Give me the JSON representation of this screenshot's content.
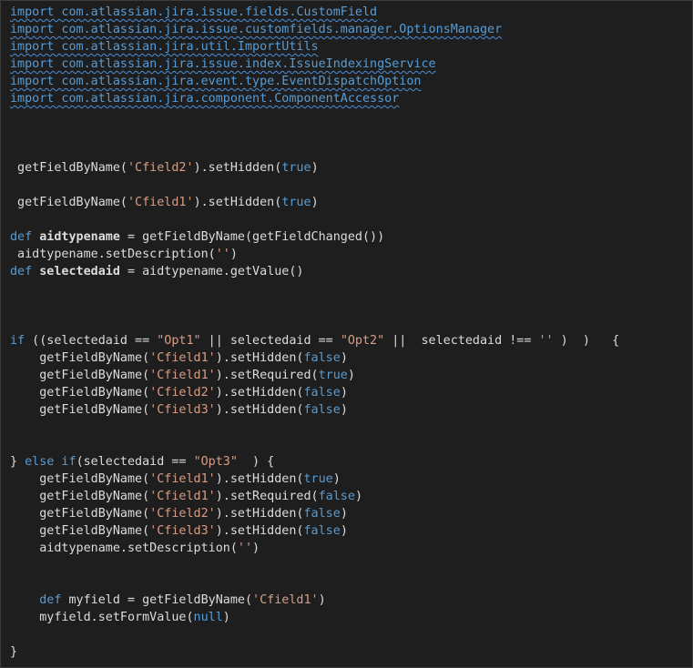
{
  "colors": {
    "background": "#1e1e1e",
    "border": "#3c3c3c",
    "plain": "#dcdcdc",
    "keyword": "#569cd6",
    "string": "#d69d85",
    "squiggle": "#4a8ed8"
  },
  "code_lines": [
    [
      [
        "imp",
        "import com.atlassian.jira.issue.fields.CustomField"
      ]
    ],
    [
      [
        "imp",
        "import com.atlassian.jira.issue.customfields.manager.OptionsManager"
      ]
    ],
    [
      [
        "imp",
        "import com.atlassian.jira.util.ImportUtils"
      ]
    ],
    [
      [
        "imp",
        "import com.atlassian.jira.issue.index.IssueIndexingService"
      ]
    ],
    [
      [
        "imp",
        "import com.atlassian.jira.event.type.EventDispatchOption"
      ]
    ],
    [
      [
        "imp",
        "import com.atlassian.jira.component.ComponentAccessor"
      ]
    ],
    [],
    [],
    [],
    [
      [
        "plain",
        " getFieldByName("
      ],
      [
        "str",
        "'Cfield2'"
      ],
      [
        "plain",
        ").setHidden("
      ],
      [
        "kw",
        "true"
      ],
      [
        "plain",
        ")"
      ]
    ],
    [],
    [
      [
        "plain",
        " getFieldByName("
      ],
      [
        "str",
        "'Cfield1'"
      ],
      [
        "plain",
        ").setHidden("
      ],
      [
        "kw",
        "true"
      ],
      [
        "plain",
        ")"
      ]
    ],
    [],
    [
      [
        "kw",
        "def "
      ],
      [
        "var",
        "aidtypename"
      ],
      [
        "plain",
        " = getFieldByName(getFieldChanged())"
      ]
    ],
    [
      [
        "plain",
        " aidtypename.setDescription("
      ],
      [
        "str",
        "''"
      ],
      [
        "plain",
        ")"
      ]
    ],
    [
      [
        "kw",
        "def "
      ],
      [
        "var",
        "selectedaid"
      ],
      [
        "plain",
        " = aidtypename.getValue()"
      ]
    ],
    [],
    [],
    [],
    [
      [
        "kw",
        "if"
      ],
      [
        "plain",
        " ((selectedaid == "
      ],
      [
        "dstr",
        "\"Opt1\""
      ],
      [
        "plain",
        " || selectedaid == "
      ],
      [
        "dstr",
        "\"Opt2\""
      ],
      [
        "plain",
        " ||  selectedaid !== "
      ],
      [
        "str",
        "''"
      ],
      [
        "plain",
        " )  )   {"
      ]
    ],
    [
      [
        "plain",
        "    getFieldByName("
      ],
      [
        "str",
        "'Cfield1'"
      ],
      [
        "plain",
        ").setHidden("
      ],
      [
        "kw",
        "false"
      ],
      [
        "plain",
        ")"
      ]
    ],
    [
      [
        "plain",
        "    getFieldByName("
      ],
      [
        "str",
        "'Cfield1'"
      ],
      [
        "plain",
        ").setRequired("
      ],
      [
        "kw",
        "true"
      ],
      [
        "plain",
        ")"
      ]
    ],
    [
      [
        "plain",
        "    getFieldByName("
      ],
      [
        "str",
        "'Cfield2'"
      ],
      [
        "plain",
        ").setHidden("
      ],
      [
        "kw",
        "false"
      ],
      [
        "plain",
        ")"
      ]
    ],
    [
      [
        "plain",
        "    getFieldByName("
      ],
      [
        "str",
        "'Cfield3'"
      ],
      [
        "plain",
        ").setHidden("
      ],
      [
        "kw",
        "false"
      ],
      [
        "plain",
        ")"
      ]
    ],
    [],
    [],
    [
      [
        "plain",
        "} "
      ],
      [
        "kw",
        "else if"
      ],
      [
        "plain",
        "(selectedaid == "
      ],
      [
        "dstr",
        "\"Opt3\""
      ],
      [
        "plain",
        "  ) {"
      ]
    ],
    [
      [
        "plain",
        "    getFieldByName("
      ],
      [
        "str",
        "'Cfield1'"
      ],
      [
        "plain",
        ").setHidden("
      ],
      [
        "kw",
        "true"
      ],
      [
        "plain",
        ")"
      ]
    ],
    [
      [
        "plain",
        "    getFieldByName("
      ],
      [
        "str",
        "'Cfield1'"
      ],
      [
        "plain",
        ").setRequired("
      ],
      [
        "kw",
        "false"
      ],
      [
        "plain",
        ")"
      ]
    ],
    [
      [
        "plain",
        "    getFieldByName("
      ],
      [
        "str",
        "'Cfield2'"
      ],
      [
        "plain",
        ").setHidden("
      ],
      [
        "kw",
        "false"
      ],
      [
        "plain",
        ")"
      ]
    ],
    [
      [
        "plain",
        "    getFieldByName("
      ],
      [
        "str",
        "'Cfield3'"
      ],
      [
        "plain",
        ").setHidden("
      ],
      [
        "kw",
        "false"
      ],
      [
        "plain",
        ")"
      ]
    ],
    [
      [
        "plain",
        "    aidtypename.setDescription("
      ],
      [
        "str",
        "''"
      ],
      [
        "plain",
        ")"
      ]
    ],
    [],
    [],
    [
      [
        "plain",
        "    "
      ],
      [
        "kw",
        "def"
      ],
      [
        "plain",
        " myfield = getFieldByName("
      ],
      [
        "str",
        "'Cfield1'"
      ],
      [
        "plain",
        ")"
      ]
    ],
    [
      [
        "plain",
        "    myfield.setFormValue("
      ],
      [
        "kw",
        "null"
      ],
      [
        "plain",
        ")"
      ]
    ],
    [],
    [
      [
        "plain",
        "}"
      ]
    ]
  ]
}
